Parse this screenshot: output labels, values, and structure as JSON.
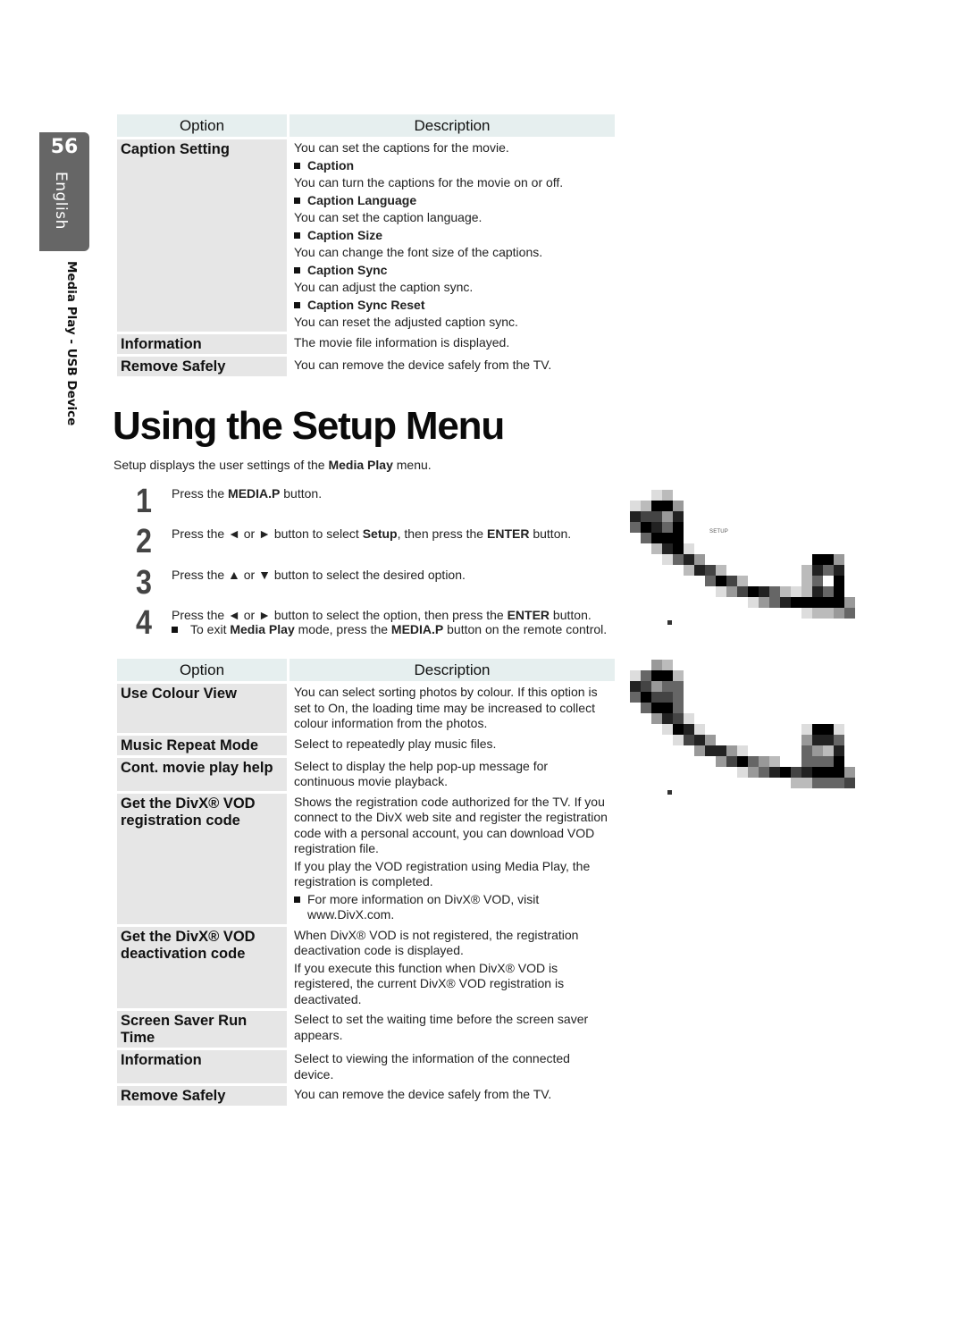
{
  "side_tab": {
    "page_number": "56",
    "language": "English",
    "section": "Media Play - USB Device"
  },
  "table1": {
    "headers": {
      "option": "Option",
      "description": "Description"
    },
    "rows": [
      {
        "option": "Caption Setting",
        "intro": "You can set the captions for the movie.",
        "items": [
          {
            "title": "Caption",
            "text": "You can turn the captions for the movie on or off."
          },
          {
            "title": "Caption Language",
            "text": "You can set the caption language."
          },
          {
            "title": "Caption Size",
            "text": "You can change the font size of the captions."
          },
          {
            "title": "Caption Sync",
            "text": "You can adjust the caption sync."
          },
          {
            "title": "Caption Sync Reset",
            "text": "You can reset the adjusted caption sync."
          }
        ]
      },
      {
        "option": "Information",
        "description": "The movie file information is displayed."
      },
      {
        "option": "Remove Safely",
        "description": "You can remove the device safely from the TV."
      }
    ]
  },
  "heading": "Using the Setup Menu",
  "intro": {
    "pre": "Setup displays the user settings of the ",
    "bold": "Media Play",
    "post": " menu."
  },
  "steps": [
    {
      "num": "1",
      "parts": [
        {
          "t": "Press the "
        },
        {
          "b": "MEDIA.P"
        },
        {
          "t": " button."
        }
      ]
    },
    {
      "num": "2",
      "parts": [
        {
          "t": "Press the ◄ or ► button to select "
        },
        {
          "b": "Setup"
        },
        {
          "t": ", then press the "
        },
        {
          "b": "ENTER"
        },
        {
          "t": "       button."
        }
      ]
    },
    {
      "num": "3",
      "parts": [
        {
          "t": "Press the ▲ or ▼ button to select the desired option."
        }
      ]
    },
    {
      "num": "4",
      "parts": [
        {
          "t": "Press the ◄ or ► button to select the option, then press the "
        },
        {
          "b": "ENTER"
        },
        {
          "t": "       button."
        }
      ],
      "note": [
        {
          "t": "To exit "
        },
        {
          "b": "Media Play"
        },
        {
          "t": " mode, press the "
        },
        {
          "b": "MEDIA.P"
        },
        {
          "t": " button on the remote control."
        }
      ]
    }
  ],
  "screenshot1": {
    "label": "SETUP"
  },
  "table2": {
    "headers": {
      "option": "Option",
      "description": "Description"
    },
    "rows": [
      {
        "option": "Use Colour View",
        "paras": [
          "You can select sorting photos by colour. If this option is set to On, the loading time may be increased to collect colour information from the photos."
        ]
      },
      {
        "option": "Music Repeat Mode",
        "paras": [
          "Select to repeatedly play music files."
        ]
      },
      {
        "option": "Cont. movie play help",
        "paras": [
          "Select to display the help pop-up message for continuous movie playback."
        ]
      },
      {
        "option": "Get the DivX® VOD registration code",
        "paras": [
          "Shows the registration code authorized for the TV. If you connect to the DivX web site and register the registration code with a personal account, you can download VOD registration file.",
          "If you play the VOD registration using Media Play, the registration is completed."
        ],
        "bullet": "For more information on DivX® VOD, visit www.DivX.com."
      },
      {
        "option": "Get the DivX® VOD deactivation code",
        "paras": [
          "When DivX® VOD is not registered, the registration deactivation code is displayed.",
          "If you execute this function when DivX® VOD is registered, the current DivX® VOD registration is deactivated."
        ]
      },
      {
        "option": "Screen Saver Run Time",
        "paras": [
          "Select to set the waiting time before the screen saver appears."
        ]
      },
      {
        "option": "Information",
        "paras": [
          "Select to viewing the information of the connected device."
        ]
      },
      {
        "option": "Remove Safely",
        "paras": [
          "You can remove the device safely from the TV."
        ]
      }
    ]
  }
}
